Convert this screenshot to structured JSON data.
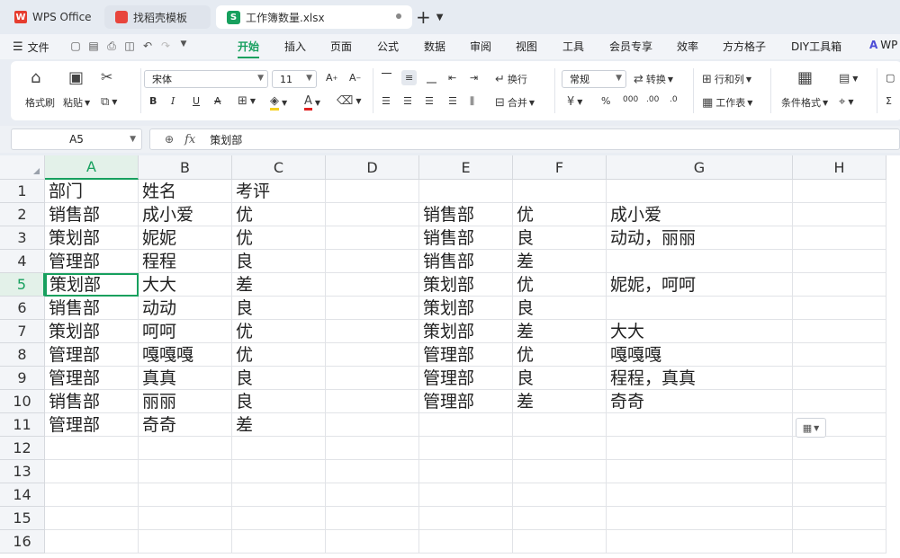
{
  "tabs": [
    {
      "label": "WPS Office",
      "icon": "wps-logo-icon"
    },
    {
      "label": "找稻壳模板",
      "icon": "docer-icon"
    },
    {
      "label": "工作簿数量.xlsx",
      "icon": "spreadsheet-icon",
      "active": true
    }
  ],
  "menu": {
    "file_label": "文件",
    "items": [
      "开始",
      "插入",
      "页面",
      "公式",
      "数据",
      "审阅",
      "视图",
      "工具",
      "会员专享",
      "效率",
      "方方格子",
      "DIY工具箱"
    ],
    "active": "开始",
    "overflow_label": "WP"
  },
  "ribbon": {
    "format_painter": "格式刷",
    "paste": "粘贴",
    "font_name": "宋体",
    "font_size": "11",
    "wrap": "换行",
    "merge": "合并",
    "number_format": "常规",
    "convert": "转换",
    "rowcol": "行和列",
    "worksheet": "工作表",
    "conditional": "条件格式",
    "font_color": "#e02020",
    "fill_color": "#f5d020"
  },
  "formula_bar": {
    "cell_ref": "A5",
    "fx_label": "fx",
    "formula": "策划部"
  },
  "sheet": {
    "columns": [
      "A",
      "B",
      "C",
      "D",
      "E",
      "F",
      "G",
      "H"
    ],
    "rows": [
      "1",
      "2",
      "3",
      "4",
      "5",
      "6",
      "7",
      "8",
      "9",
      "10",
      "11",
      "12",
      "13",
      "14",
      "15",
      "16"
    ],
    "selected_cell": "A5",
    "cells": {
      "A1": "部门",
      "B1": "姓名",
      "C1": "考评",
      "A2": "销售部",
      "B2": "成小爱",
      "C2": "优",
      "A3": "策划部",
      "B3": "妮妮",
      "C3": "优",
      "A4": "管理部",
      "B4": "程程",
      "C4": "良",
      "A5": "策划部",
      "B5": "大大",
      "C5": "差",
      "A6": "销售部",
      "B6": "动动",
      "C6": "良",
      "A7": "策划部",
      "B7": "呵呵",
      "C7": "优",
      "A8": "管理部",
      "B8": "嘎嘎嘎",
      "C8": "优",
      "A9": "管理部",
      "B9": "真真",
      "C9": "良",
      "A10": "销售部",
      "B10": "丽丽",
      "C10": "良",
      "A11": "管理部",
      "B11": "奇奇",
      "C11": "差",
      "E2": "销售部",
      "F2": "优",
      "G2": "成小爱",
      "E3": "销售部",
      "F3": "良",
      "G3": "动动，丽丽",
      "E4": "销售部",
      "F4": "差",
      "E5": "策划部",
      "F5": "优",
      "G5": "妮妮，呵呵",
      "E6": "策划部",
      "F6": "良",
      "E7": "策划部",
      "F7": "差",
      "G7": "大大",
      "E8": "管理部",
      "F8": "优",
      "G8": "嘎嘎嘎",
      "E9": "管理部",
      "F9": "良",
      "G9": "程程，真真",
      "E10": "管理部",
      "F10": "差",
      "G10": "奇奇"
    }
  }
}
